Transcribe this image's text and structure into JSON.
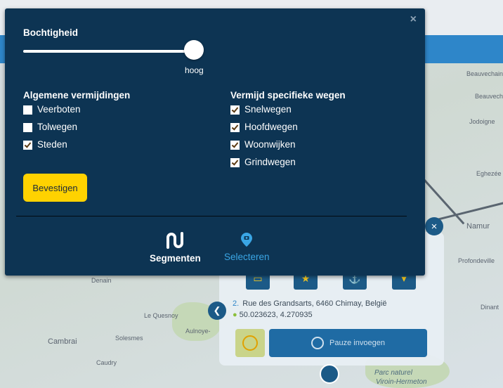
{
  "map": {
    "labels": [
      "Beauvechain",
      "Jodoigne",
      "Eghezée",
      "Namur",
      "Profondeville",
      "Dinant",
      "Denain",
      "Le Quesnoy",
      "Aulnoye-",
      "Cambrai",
      "Solesmes",
      "Caudry",
      "Parc naturel",
      "Viroin-Hermeton"
    ]
  },
  "route_card": {
    "step_number": "2.",
    "step_address": "Rue des Grandsarts, 6460 Chimay, België",
    "coordinates": "50.023623, 4.270935",
    "pause_label": "Pauze invoegen"
  },
  "modal": {
    "close_symbol": "×",
    "curviness": {
      "title": "Bochtigheid",
      "value_label": "hoog",
      "level": 1.0
    },
    "general_avoid": {
      "title": "Algemene vermijdingen",
      "options": [
        {
          "label": "Veerboten",
          "checked": false
        },
        {
          "label": "Tolwegen",
          "checked": false
        },
        {
          "label": "Steden",
          "checked": true
        }
      ]
    },
    "specific_avoid": {
      "title": "Vermijd specifieke wegen",
      "options": [
        {
          "label": "Snelwegen",
          "checked": true
        },
        {
          "label": "Hoofdwegen",
          "checked": true
        },
        {
          "label": "Woonwijken",
          "checked": true
        },
        {
          "label": "Grindwegen",
          "checked": true
        }
      ]
    },
    "confirm_label": "Bevestigen",
    "modes": [
      {
        "label": "Segmenten",
        "active": false
      },
      {
        "label": "Selecteren",
        "active": true
      }
    ]
  },
  "colors": {
    "modal_bg": "#0d3453",
    "accent_yellow": "#ffd200",
    "accent_blue": "#3aa6e5"
  },
  "icons": [
    "close-icon",
    "segments-icon",
    "select-pin-icon",
    "chevron-left-icon",
    "clock-icon",
    "pause-icon"
  ]
}
